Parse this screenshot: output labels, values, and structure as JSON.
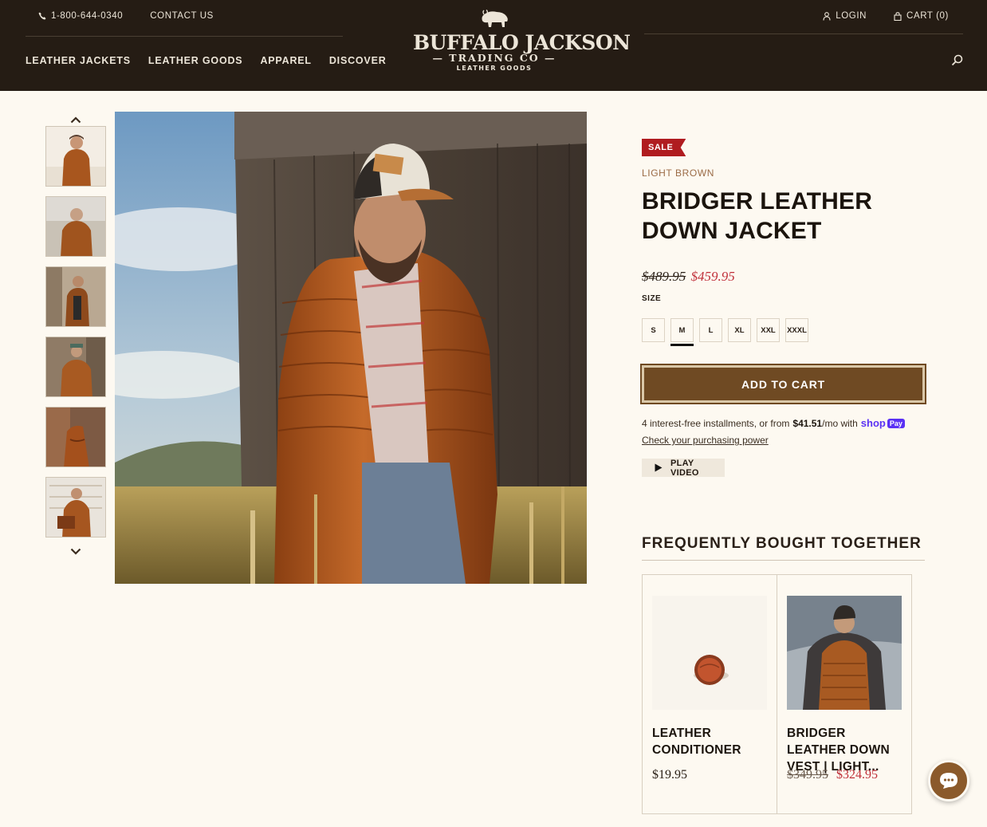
{
  "header": {
    "phone": "1-800-644-0340",
    "contact": "CONTACT US",
    "login": "LOGIN",
    "cart": "CART (0)",
    "nav": [
      "LEATHER JACKETS",
      "LEATHER GOODS",
      "APPAREL",
      "DISCOVER"
    ],
    "logo": {
      "line1": "BUFFALO JACKSON",
      "line2": "— TRADING CO —",
      "line3": "LEATHER GOODS"
    }
  },
  "product": {
    "badge": "SALE",
    "color": "LIGHT BROWN",
    "title": "BRIDGER LEATHER DOWN JACKET",
    "price_old": "$489.95",
    "price_new": "$459.95",
    "size_label": "SIZE",
    "sizes": [
      "S",
      "M",
      "L",
      "XL",
      "XXL",
      "XXXL"
    ],
    "selected_size": "M",
    "add_to_cart": "ADD TO CART",
    "installments_text": "4 interest-free installments, or from",
    "installments_amount": "$41.51",
    "installments_suffix": "/mo with",
    "shoppay_brand": "shop",
    "shoppay_pay": "Pay",
    "check_power": "Check your purchasing power",
    "play_video": "PLAY VIDEO"
  },
  "fbt": {
    "title": "FREQUENTLY BOUGHT TOGETHER",
    "items": [
      {
        "name": "LEATHER CONDITIONER",
        "price": "$19.95"
      },
      {
        "name": "BRIDGER LEATHER DOWN VEST | LIGHT...",
        "price_old": "$349.95",
        "price_new": "$324.95"
      }
    ]
  },
  "colors": {
    "header_bg": "#251c14",
    "accent": "#6f4a23",
    "sale_red": "#b01c20",
    "price_red": "#c0303a",
    "page_bg": "#fdf9f1"
  }
}
